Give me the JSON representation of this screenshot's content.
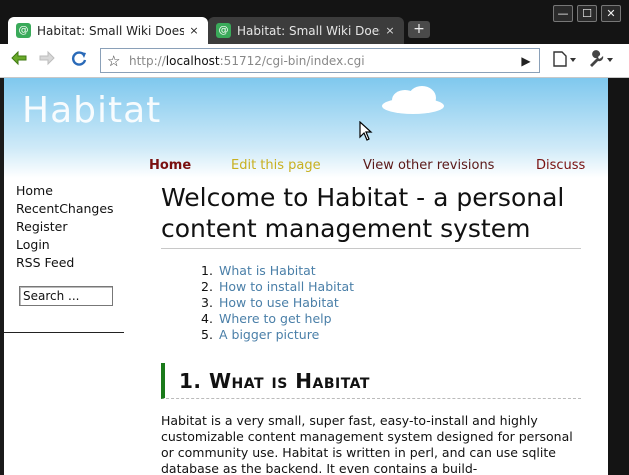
{
  "browser": {
    "tabs": [
      {
        "title": "Habitat: Small Wiki Does...",
        "close": "×",
        "favicon": "@"
      },
      {
        "title": "Habitat: Small Wiki Does...",
        "close": "×",
        "favicon": "@"
      }
    ],
    "new_tab": "+",
    "window_controls": {
      "minimize": "—",
      "maximize": "☐",
      "close": "✕"
    },
    "url_scheme": "http://",
    "url_host": "localhost",
    "url_rest": ":51712/cgi-bin/index.cgi",
    "colors": {
      "favicon": "#3aaa5a",
      "omnibox_border": "#8aa0b8"
    }
  },
  "site": {
    "logo": "Habitat",
    "nav": {
      "home": "Home",
      "edit": "Edit this page",
      "revisions": "View other revisions",
      "discuss": "Discuss"
    },
    "sidebar": {
      "links": [
        "Home",
        "RecentChanges",
        "Register",
        "Login",
        "RSS Feed"
      ],
      "search_value": "Search ..."
    },
    "title": "Welcome to Habitat - a personal content management system",
    "toc": [
      {
        "n": "1.",
        "label": "What is Habitat"
      },
      {
        "n": "2.",
        "label": "How to install Habitat"
      },
      {
        "n": "3.",
        "label": "How to use Habitat"
      },
      {
        "n": "4.",
        "label": "Where to get help"
      },
      {
        "n": "5.",
        "label": "A bigger picture"
      }
    ],
    "section_heading": "1. What is Habitat",
    "paragraph": "Habitat is a very small, super fast, easy-to-install and highly customizable content management system designed for personal or community use. Habitat is written in perl, and can use sqlite database as the backend. It even contains a build-",
    "colors": {
      "nav_home": "#7a1010",
      "nav_edit": "#c8b020",
      "toc_link": "#4a7fa8",
      "heading_bar": "#1a7a1a"
    }
  }
}
